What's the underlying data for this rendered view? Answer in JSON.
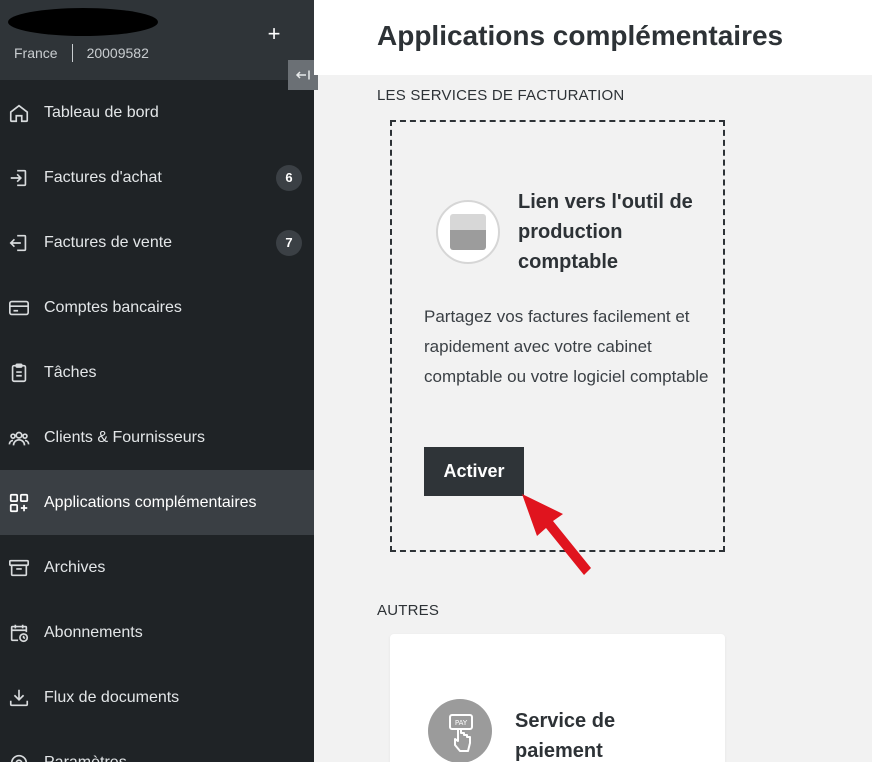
{
  "sidebar": {
    "company": {
      "country": "France",
      "id": "20009582"
    },
    "plus_label": "+",
    "items": [
      {
        "label": "Tableau de bord",
        "icon": "home-icon"
      },
      {
        "label": "Factures d'achat",
        "icon": "login-icon",
        "badge": "6"
      },
      {
        "label": "Factures de vente",
        "icon": "logout-icon",
        "badge": "7"
      },
      {
        "label": "Comptes bancaires",
        "icon": "credit-card-icon"
      },
      {
        "label": "Tâches",
        "icon": "clipboard-icon"
      },
      {
        "label": "Clients & Fournisseurs",
        "icon": "users-icon"
      },
      {
        "label": "Applications complémentaires",
        "icon": "apps-add-icon",
        "active": true
      },
      {
        "label": "Archives",
        "icon": "archive-box-icon"
      },
      {
        "label": "Abonnements",
        "icon": "calendar-refresh-icon"
      },
      {
        "label": "Flux de documents",
        "icon": "download-tray-icon"
      },
      {
        "label": "Paramètres",
        "icon": "settings-icon"
      }
    ]
  },
  "main": {
    "title": "Applications complémentaires",
    "sections": [
      {
        "title": "LES SERVICES DE FACTURATION",
        "app": {
          "name": "Lien vers l'outil de production comptable",
          "description": "Partagez vos factures facilement et rapidement avec votre cabinet comptable ou votre logiciel comptable",
          "button_label": "Activer"
        }
      },
      {
        "title": "AUTRES",
        "app": {
          "name": "Service de paiement",
          "logo_text": "PAY"
        }
      }
    ]
  },
  "colors": {
    "sidebar_bg": "#1f2326",
    "active_bg": "#3a3f44",
    "button_bg": "#2f3438",
    "arrow": "#e0141e"
  }
}
